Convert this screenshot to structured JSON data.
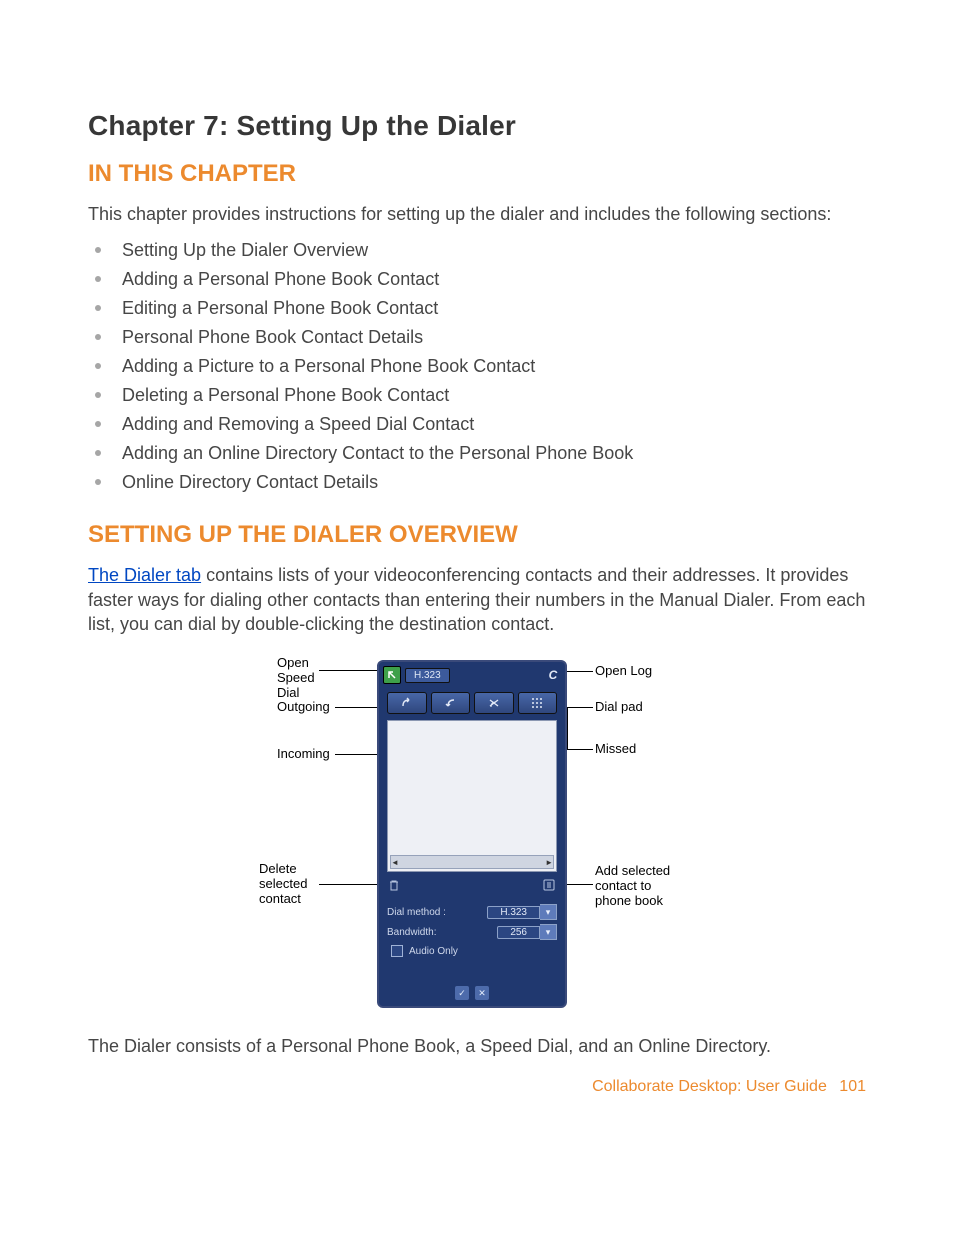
{
  "chapter_title": "Chapter 7:   Setting Up the Dialer",
  "section1": "IN THIS CHAPTER",
  "intro": "This chapter provides instructions for setting up the dialer and includes the following sections:",
  "toc": [
    "Setting Up the Dialer Overview",
    "Adding a Personal Phone Book Contact",
    "Editing a Personal Phone Book Contact",
    "Personal Phone Book Contact Details",
    "Adding a Picture to a Personal Phone Book Contact",
    "Deleting a Personal Phone Book Contact",
    "Adding and Removing a Speed Dial Contact",
    "Adding an Online Directory Contact to the Personal Phone Book",
    "Online Directory Contact Details"
  ],
  "section2": "SETTING UP THE DIALER OVERVIEW",
  "para2_link": "The Dialer tab",
  "para2_rest": " contains lists of your videoconferencing contacts and their addresses. It provides faster ways for dialing other contacts than entering their numbers in the Manual Dialer. From each list, you can dial by double-clicking the destination contact.",
  "figure": {
    "callouts": {
      "open_speed_dial": "Open Speed Dial",
      "outgoing": "Outgoing",
      "incoming": "Incoming",
      "delete": "Delete selected contact",
      "open_log": "Open Log",
      "dial_pad": "Dial pad",
      "missed": "Missed",
      "add_contact": "Add selected contact to phone book"
    },
    "device": {
      "tab_label": "H.323",
      "dial_method_label": "Dial method :",
      "dial_method_value": "H.323",
      "bandwidth_label": "Bandwidth:",
      "bandwidth_value": "256",
      "audio_only": "Audio Only"
    }
  },
  "para3": "The Dialer consists of a Personal Phone Book, a Speed Dial, and an Online Directory.",
  "footer_title": "Collaborate Desktop: User Guide",
  "footer_page": "101"
}
